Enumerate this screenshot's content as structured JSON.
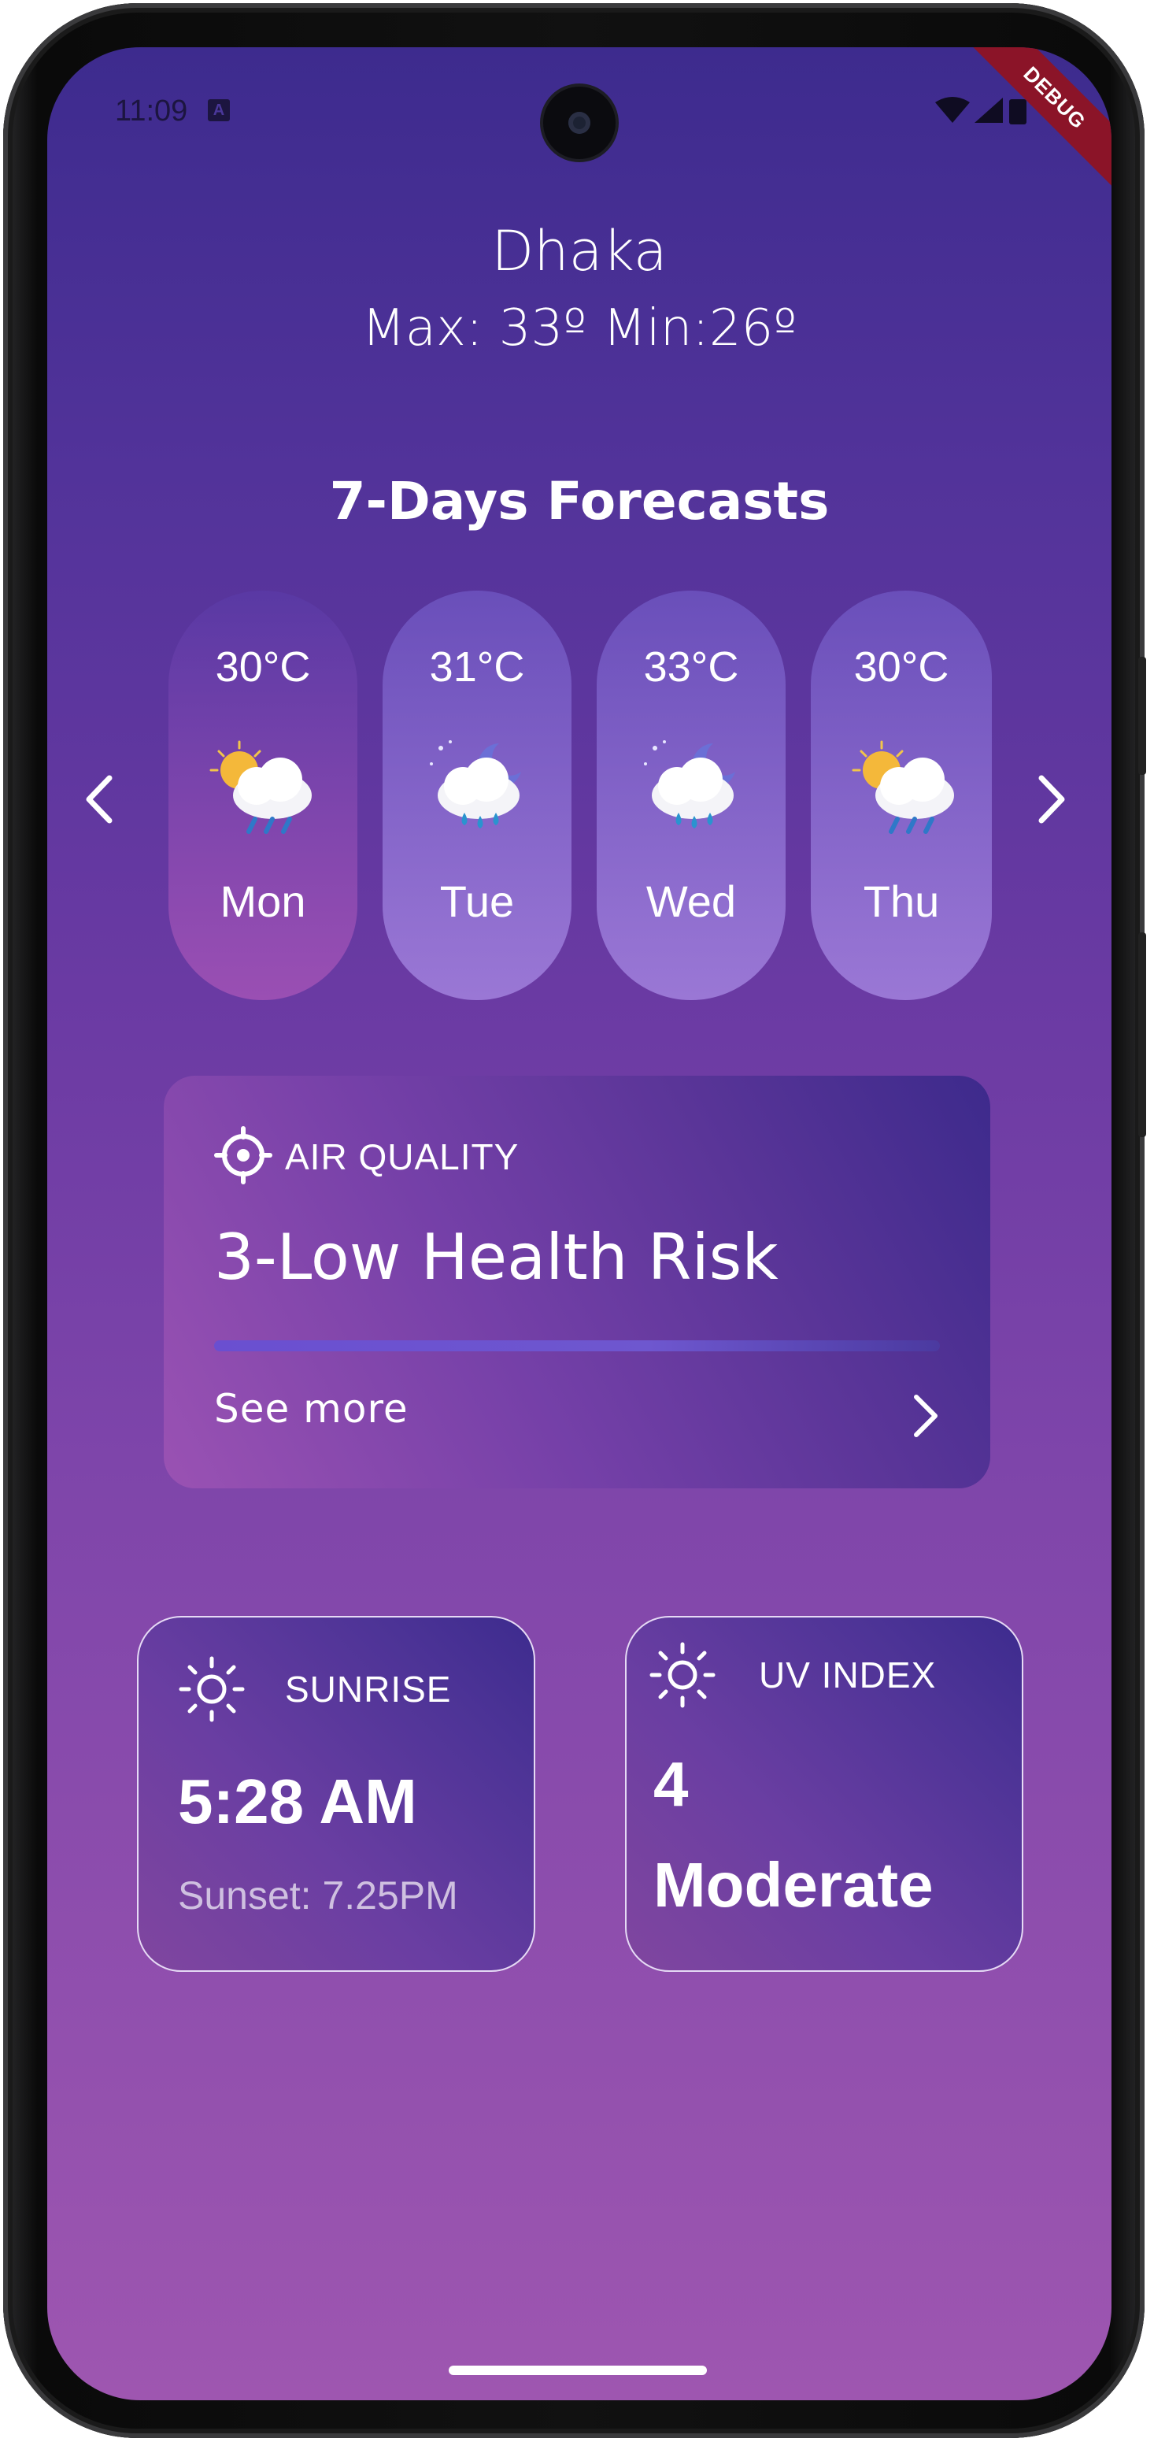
{
  "status_bar": {
    "time": "11:09",
    "debug_banner": "DEBUG"
  },
  "header": {
    "city": "Dhaka",
    "minmax": "Max: 33º Min:26º"
  },
  "forecast": {
    "title": "7-Days Forecasts",
    "days": [
      {
        "temp": "30°C",
        "day": "Mon",
        "icon": "sun-cloud-rain-icon"
      },
      {
        "temp": "31°C",
        "day": "Tue",
        "icon": "moon-cloud-rain-icon"
      },
      {
        "temp": "33°C",
        "day": "Wed",
        "icon": "moon-cloud-rain-icon"
      },
      {
        "temp": "30°C",
        "day": "Thu",
        "icon": "sun-cloud-rain-icon"
      }
    ]
  },
  "air_quality": {
    "label": "AIR QUALITY",
    "value": "3-Low Health Risk",
    "level_fraction": 1.0,
    "see_more": "See more"
  },
  "sunrise": {
    "label": "SUNRISE",
    "time": "5:28 AM",
    "sunset": "Sunset: 7.25PM"
  },
  "uv_index": {
    "label": "UV INDEX",
    "value": "4",
    "level": "Moderate"
  },
  "colors": {
    "bg_top": "#3d2b8e",
    "bg_bottom": "#9e56b0",
    "accent_bar": "#6a4fd0"
  }
}
